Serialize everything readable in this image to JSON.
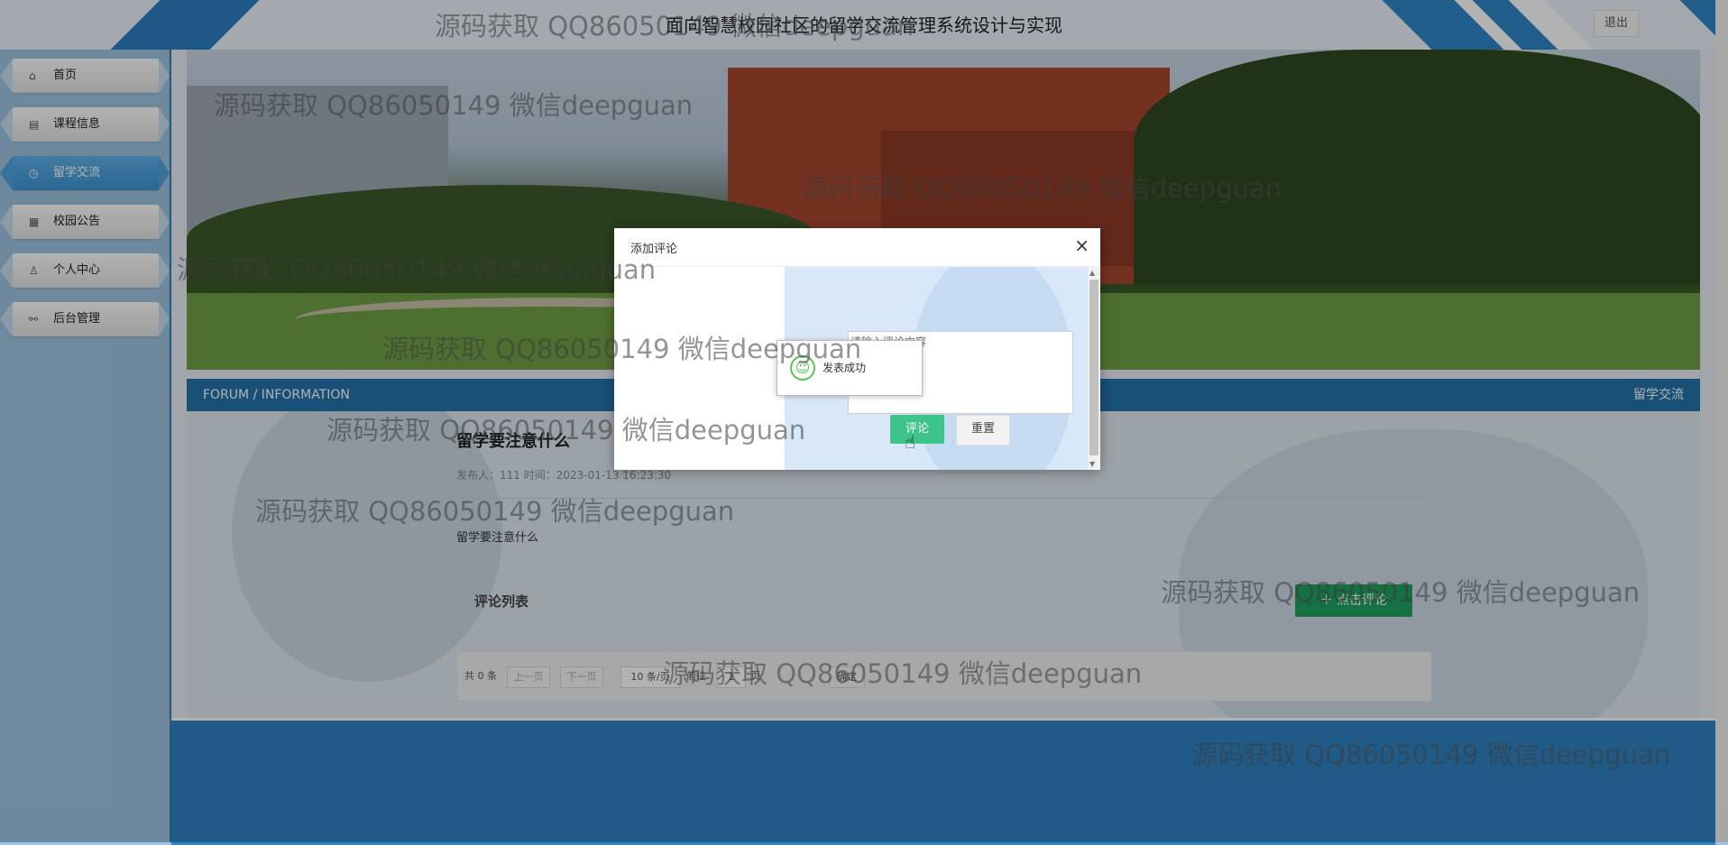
{
  "header": {
    "title": "面向智慧校园社区的留学交流管理系统设计与实现",
    "logout_label": "退出"
  },
  "sidebar": {
    "items": [
      {
        "label": "首页",
        "icon": "home-icon",
        "glyph": "⌂",
        "active": false
      },
      {
        "label": "课程信息",
        "icon": "document-icon",
        "glyph": "▤",
        "active": false
      },
      {
        "label": "留学交流",
        "icon": "clock-icon",
        "glyph": "◷",
        "active": true
      },
      {
        "label": "校园公告",
        "icon": "notice-icon",
        "glyph": "▦",
        "active": false
      },
      {
        "label": "个人中心",
        "icon": "user-icon",
        "glyph": "♙",
        "active": false
      },
      {
        "label": "后台管理",
        "icon": "link-icon",
        "glyph": "⚯",
        "active": false
      }
    ]
  },
  "forum_bar": {
    "left": "FORUM / INFORMATION",
    "right": "留学交流"
  },
  "post": {
    "title": "留学要注意什么",
    "meta": "发布人：111 时间：2023-01-13 16:23:30",
    "body": "留学要注意什么"
  },
  "comments": {
    "heading": "评论列表",
    "add_button": "＋ 点击评论"
  },
  "pager": {
    "total": "共 0 条",
    "prev": "上一页",
    "next": "下一页",
    "page_size": "10 条/页",
    "goto_prefix": "前往",
    "page_value": "1",
    "page_suffix": "页",
    "confirm": "确定"
  },
  "modal": {
    "title": "添加评论",
    "close": "×",
    "textarea_placeholder": "请输入评论内容",
    "submit_label": "评论",
    "reset_label": "重置"
  },
  "toast": {
    "message": "发表成功"
  },
  "watermark": "源码获取 QQ86050149 微信deepguan",
  "colors": {
    "primary": "#2573ac",
    "sidebar_bg": "#9ec5e3",
    "active_item": "#4ea4de",
    "comment_button": "#1fa15f",
    "submit_button": "#3cc48a"
  }
}
